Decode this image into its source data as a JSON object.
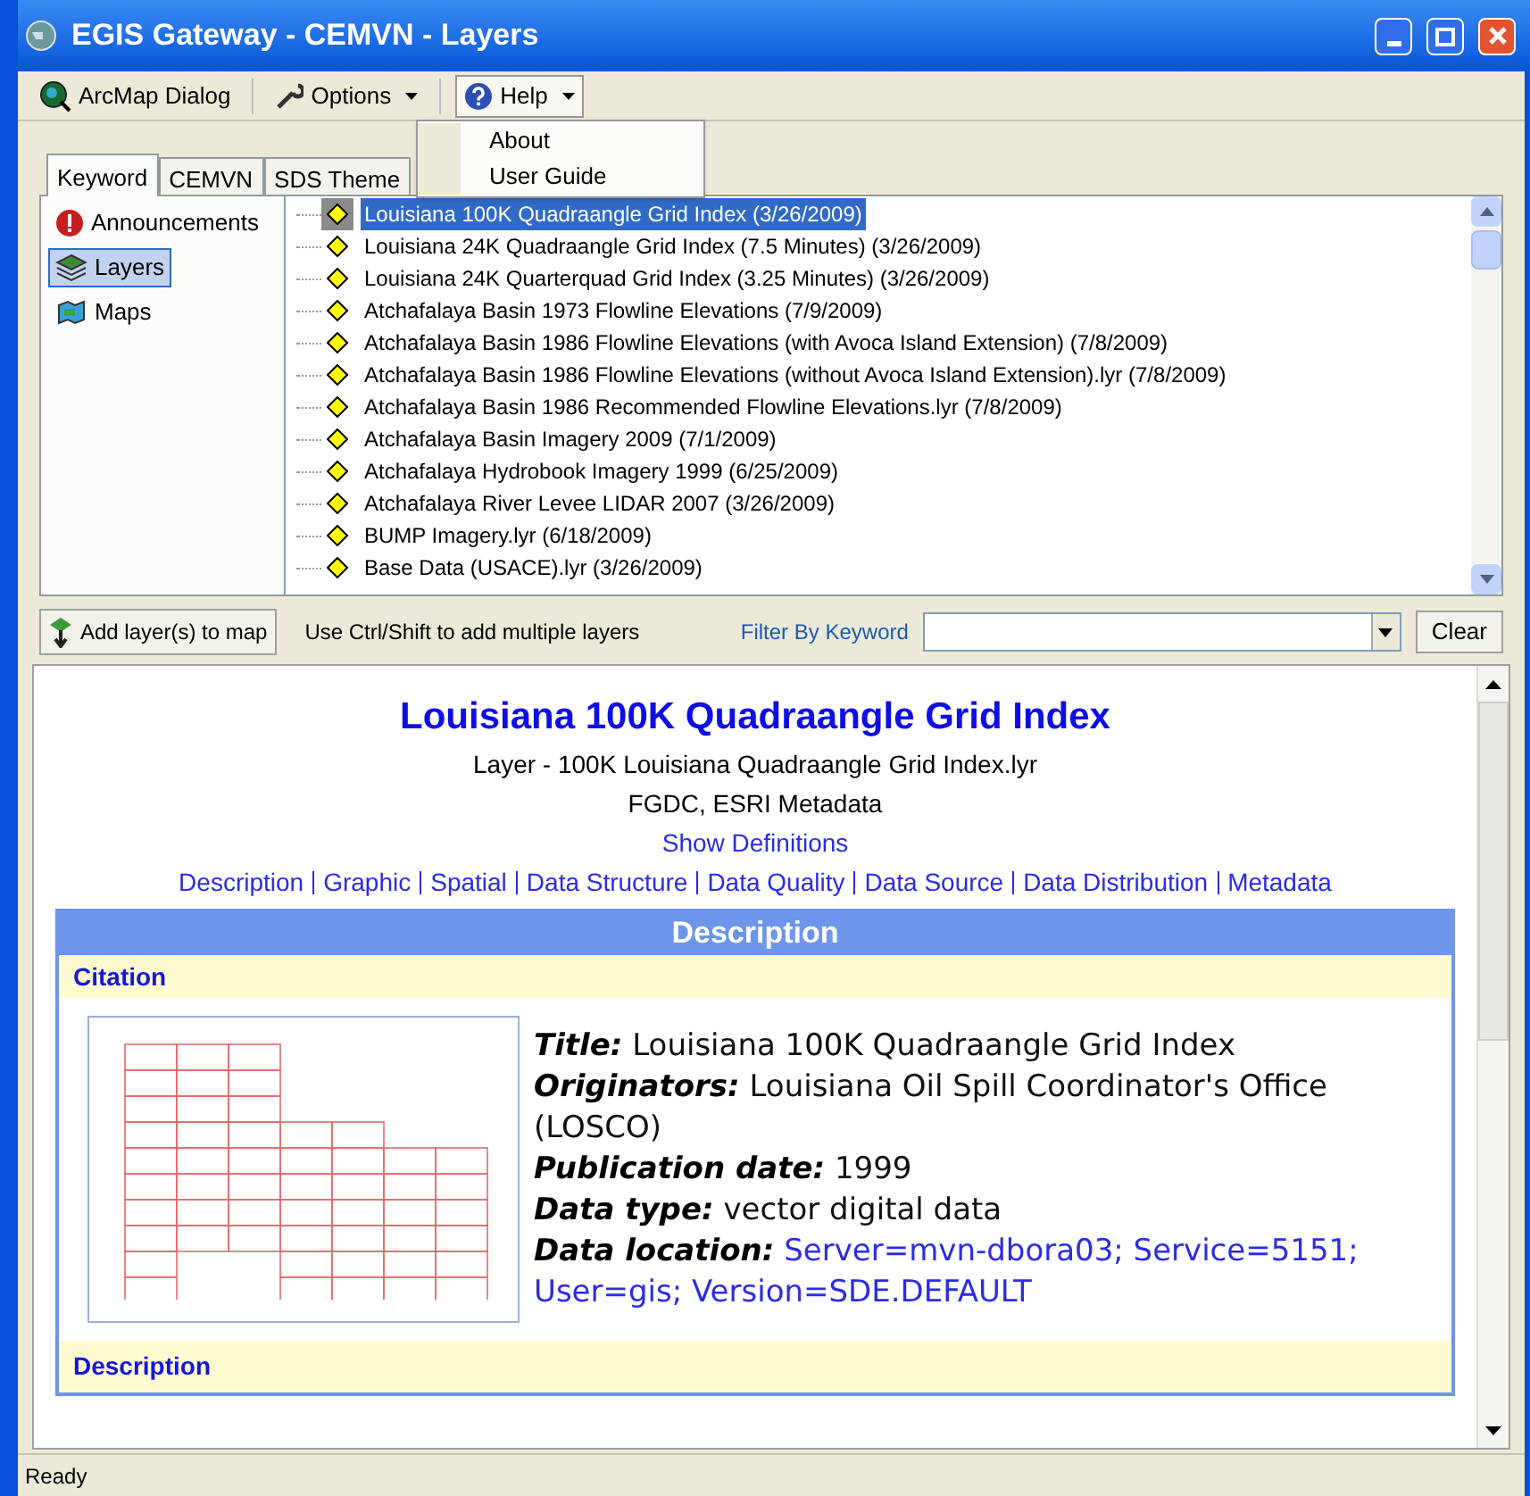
{
  "window": {
    "title": "EGIS Gateway - CEMVN - Layers"
  },
  "toolbar": [
    {
      "label": "ArcMap Dialog",
      "kind": "button"
    },
    {
      "label": "Options",
      "kind": "dropdown"
    },
    {
      "label": "Help",
      "kind": "dropdown",
      "expanded": true
    }
  ],
  "help_menu": [
    "About",
    "User Guide"
  ],
  "tabs": [
    {
      "label": "Keyword",
      "selected": true
    },
    {
      "label": "CEMVN",
      "selected": false
    },
    {
      "label": "SDS Theme",
      "selected": false
    }
  ],
  "sidebar": [
    {
      "label": "Announcements",
      "kind": "alert",
      "selected": false
    },
    {
      "label": "Layers",
      "kind": "layers",
      "selected": true
    },
    {
      "label": "Maps",
      "kind": "maps",
      "selected": false
    }
  ],
  "layers": [
    {
      "label": "Louisiana 100K Quadraangle Grid Index (3/26/2009)",
      "selected": true
    },
    {
      "label": "Louisiana 24K Quadraangle Grid Index (7.5 Minutes) (3/26/2009)",
      "selected": false
    },
    {
      "label": "Louisiana 24K Quarterquad Grid Index (3.25 Minutes) (3/26/2009)",
      "selected": false
    },
    {
      "label": "Atchafalaya Basin 1973 Flowline Elevations (7/9/2009)",
      "selected": false
    },
    {
      "label": "Atchafalaya Basin 1986 Flowline Elevations (with Avoca Island Extension) (7/8/2009)",
      "selected": false
    },
    {
      "label": "Atchafalaya Basin 1986 Flowline Elevations (without Avoca Island Extension).lyr (7/8/2009)",
      "selected": false
    },
    {
      "label": "Atchafalaya Basin 1986 Recommended Flowline Elevations.lyr (7/8/2009)",
      "selected": false
    },
    {
      "label": "Atchafalaya Basin Imagery 2009 (7/1/2009)",
      "selected": false
    },
    {
      "label": "Atchafalaya Hydrobook Imagery 1999 (6/25/2009)",
      "selected": false
    },
    {
      "label": "Atchafalaya River Levee LIDAR 2007 (3/26/2009)",
      "selected": false
    },
    {
      "label": "BUMP Imagery.lyr (6/18/2009)",
      "selected": false
    },
    {
      "label": "Base Data (USACE).lyr (3/26/2009)",
      "selected": false
    }
  ],
  "action_bar": {
    "add_button": "Add layer(s) to map",
    "hint": "Use Ctrl/Shift to add multiple layers",
    "filter_label": "Filter By Keyword",
    "clear_button": "Clear"
  },
  "metadata": {
    "title": "Louisiana 100K Quadraangle Grid Index",
    "layer": "Layer - 100K Louisiana Quadraangle Grid Index.lyr",
    "format": "FGDC, ESRI Metadata",
    "show_definitions": "Show Definitions",
    "nav_links": [
      "Description",
      "Graphic",
      "Spatial",
      "Data Structure",
      "Data Quality",
      "Data Source",
      "Data Distribution",
      "Metadata"
    ],
    "section_title": "Description",
    "subsection": "Citation",
    "fields": [
      {
        "label": "Title:",
        "value": "Louisiana 100K Quadraangle Grid Index",
        "kind": "text"
      },
      {
        "label": "Originators:",
        "value": "Louisiana Oil Spill Coordinator's Office (LOSCO)",
        "kind": "text"
      },
      {
        "label": "Publication date:",
        "value": "1999",
        "kind": "text"
      },
      {
        "label": "Data type:",
        "value": "vector digital data",
        "kind": "text"
      },
      {
        "label": "Data location:",
        "value": "Server=mvn-dbora03; Service=5151; User=gis; Version=SDE.DEFAULT",
        "kind": "link"
      }
    ],
    "next_subsection": "Description"
  },
  "status_bar": "Ready"
}
